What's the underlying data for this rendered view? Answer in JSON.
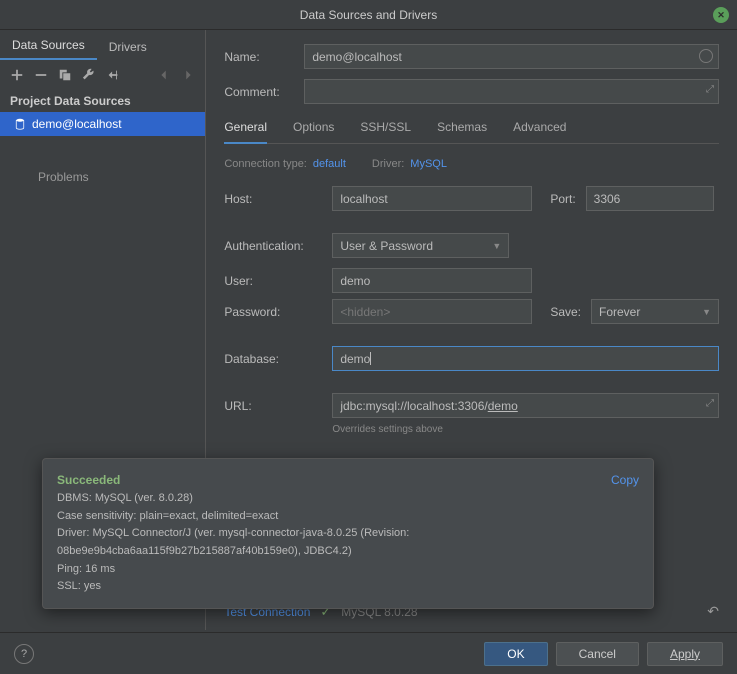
{
  "title": "Data Sources and Drivers",
  "leftTabs": {
    "dataSources": "Data Sources",
    "drivers": "Drivers"
  },
  "sectionHeader": "Project Data Sources",
  "treeItem": "demo@localhost",
  "problems": "Problems",
  "labels": {
    "name": "Name:",
    "comment": "Comment:",
    "host": "Host:",
    "port": "Port:",
    "authentication": "Authentication:",
    "user": "User:",
    "password": "Password:",
    "save": "Save:",
    "database": "Database:",
    "url": "URL:"
  },
  "tabs": {
    "general": "General",
    "options": "Options",
    "sshssl": "SSH/SSL",
    "schemas": "Schemas",
    "advanced": "Advanced"
  },
  "connInfo": {
    "connTypeLabel": "Connection type:",
    "connTypeValue": "default",
    "driverLabel": "Driver:",
    "driverValue": "MySQL"
  },
  "values": {
    "name": "demo@localhost",
    "host": "localhost",
    "port": "3306",
    "authDropdown": "User & Password",
    "user": "demo",
    "passwordPlaceholder": "<hidden>",
    "saveDropdown": "Forever",
    "database": "demo",
    "urlPrefix": "jdbc:mysql://localhost:3306/",
    "urlDemo": "demo"
  },
  "overrideNote": "Overrides settings above",
  "popup": {
    "success": "Succeeded",
    "copy": "Copy",
    "line1": "DBMS: MySQL (ver. 8.0.28)",
    "line2": "Case sensitivity: plain=exact, delimited=exact",
    "line3": "Driver: MySQL Connector/J (ver. mysql-connector-java-8.0.25 (Revision:",
    "line4": "08be9e9b4cba6aa115f9b27b215887af40b159e0), JDBC4.2)",
    "line5": "Ping: 16 ms",
    "line6": "SSL: yes"
  },
  "bottomBar": {
    "testConnection": "Test Connection",
    "version": "MySQL 8.0.28"
  },
  "footer": {
    "ok": "OK",
    "cancel": "Cancel",
    "apply": "Apply"
  }
}
